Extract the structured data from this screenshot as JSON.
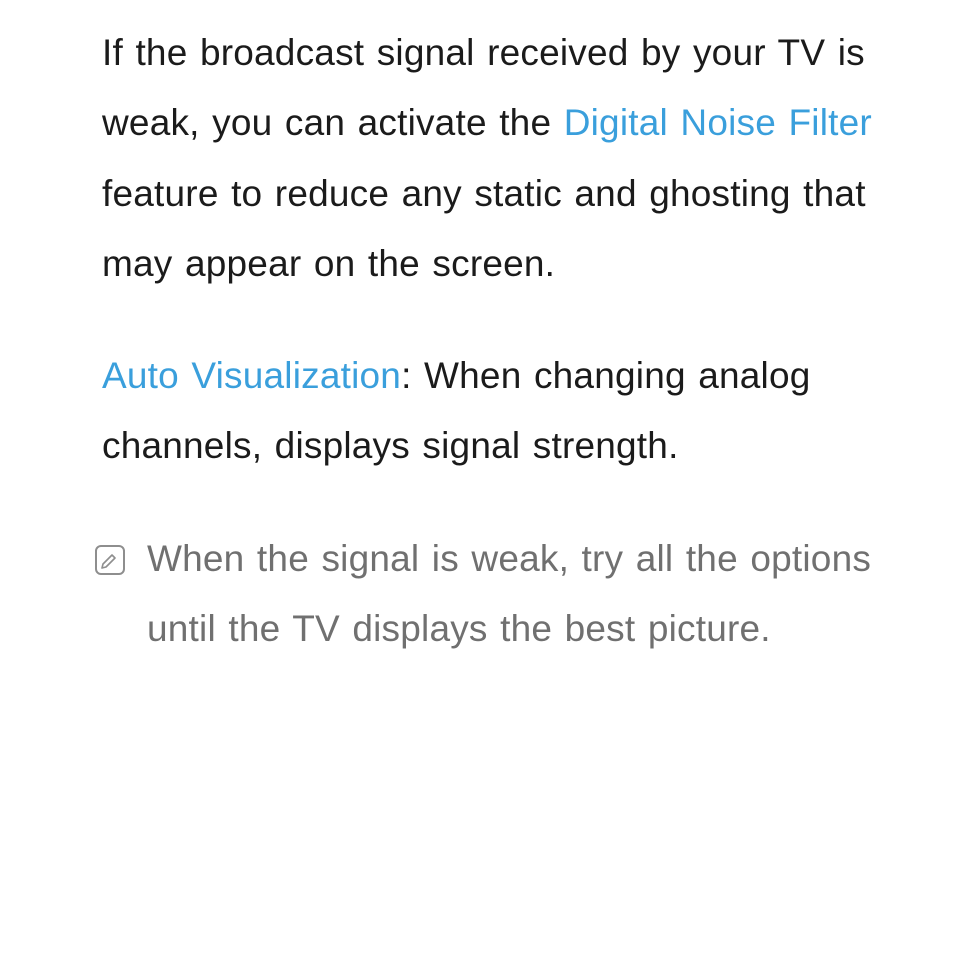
{
  "paragraphs": {
    "p1": {
      "before": "If the broadcast signal received by your TV is weak, you can activate the ",
      "highlight": "Digital Noise Filter",
      "after": " feature to reduce any static and ghosting that may appear on the screen."
    },
    "p2": {
      "highlight": "Auto Visualization",
      "after": ": When changing analog channels, displays signal strength."
    },
    "note": {
      "icon_name": "note-icon",
      "text": "When the signal is weak, try all the options until the TV displays the best picture."
    }
  },
  "colors": {
    "highlight": "#3a9fdc",
    "body_text": "#1b1b1b",
    "note_text": "#707070",
    "note_icon_border": "#8e8e8e"
  }
}
